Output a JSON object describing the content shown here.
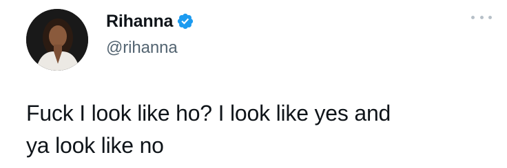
{
  "tweet": {
    "author": {
      "display_name": "Rihanna",
      "handle": "@rihanna",
      "verified": true,
      "avatar_icon": "profile-photo",
      "verified_icon": "verified-badge-icon",
      "verified_color": "#1d9bf0"
    },
    "more_icon": "more-options-icon",
    "text_line_1": "Fuck I look like ho? I look like yes and",
    "text_line_2": "ya look like no"
  }
}
